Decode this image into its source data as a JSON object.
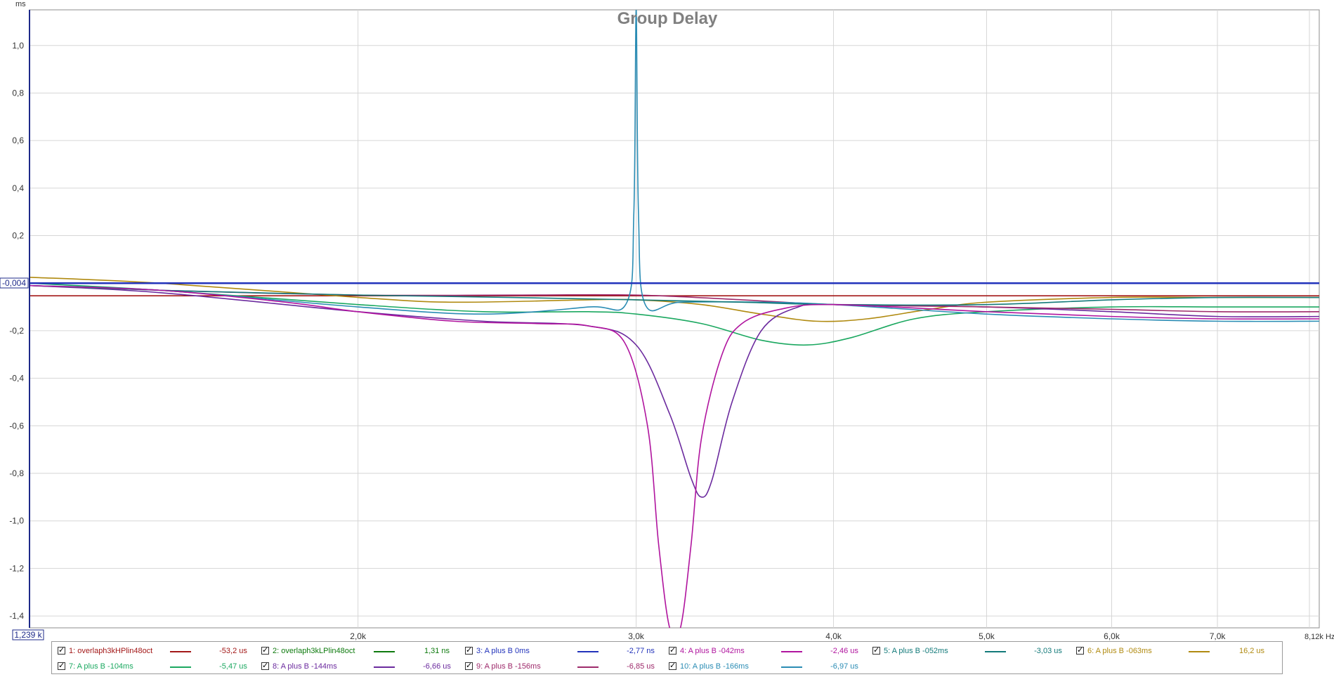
{
  "chart_data": {
    "type": "line",
    "title": "Group Delay",
    "ylabel": "ms",
    "x_unit": "Hz",
    "x_scale": "log",
    "xlim": [
      1239,
      8120
    ],
    "ylim": [
      -1.45,
      1.15
    ],
    "grid": true,
    "y_ticks": [
      1.0,
      0.8,
      0.6,
      0.4,
      0.2,
      -0.2,
      -0.4,
      -0.6,
      -0.8,
      -1.0,
      -1.2,
      -1.4
    ],
    "y_tick_labels": [
      "1,0",
      "0,8",
      "0,6",
      "0,4",
      "0,2",
      "-0,2",
      "-0,4",
      "-0,6",
      "-0,8",
      "-1,0",
      "-1,2",
      "-1,4"
    ],
    "x_ticks": [
      2000,
      3000,
      4000,
      5000,
      6000,
      7000
    ],
    "x_tick_labels": [
      "2,0k",
      "3,0k",
      "4,0k",
      "5,0k",
      "6,0k",
      "7,0k"
    ],
    "x_end_label": "8,12k Hz",
    "x_start_label": "1,239 k",
    "y_cursor_label": "-0,004",
    "y_cursor_value": -0.004,
    "legend_position": "bottom",
    "series": [
      {
        "name": "1: overlaph3kHPlin48oct",
        "value_label": "-53,2 us",
        "color": "#a31818",
        "x": [
          1239,
          1500,
          2000,
          3000,
          4000,
          5000,
          6000,
          7000,
          8120
        ],
        "y": [
          -0.053,
          -0.053,
          -0.053,
          -0.053,
          -0.053,
          -0.053,
          -0.053,
          -0.053,
          -0.053
        ]
      },
      {
        "name": "2: overlaph3kLPlin48oct",
        "value_label": "1,31 ns",
        "color": "#0e7a0e",
        "x": [
          1239,
          2000,
          4000,
          8120
        ],
        "y": [
          0.0,
          0.0,
          0.0,
          0.0
        ]
      },
      {
        "name": "3: A plus B 0ms",
        "value_label": "-2,77 ns",
        "color": "#2233bb",
        "x": [
          1239,
          2000,
          4000,
          8120
        ],
        "y": [
          0.0,
          0.0,
          0.0,
          0.0
        ]
      },
      {
        "name": "4: A plus B -042ms",
        "value_label": "-2,46 us",
        "color": "#b0149e",
        "x": [
          1239,
          1500,
          1800,
          2000,
          2300,
          2600,
          2800,
          2950,
          3050,
          3100,
          3150,
          3200,
          3250,
          3300,
          3400,
          3500,
          3700,
          4000,
          5000,
          6000,
          7000,
          8120
        ],
        "y": [
          -0.01,
          -0.03,
          -0.08,
          -0.12,
          -0.16,
          -0.17,
          -0.18,
          -0.25,
          -0.6,
          -1.1,
          -1.45,
          -1.45,
          -1.1,
          -0.65,
          -0.3,
          -0.17,
          -0.11,
          -0.09,
          -0.12,
          -0.14,
          -0.15,
          -0.15
        ]
      },
      {
        "name": "5: A plus B -052ms",
        "value_label": "-3,03 us",
        "color": "#137a7a",
        "x": [
          1239,
          1500,
          2000,
          2500,
          3000,
          3500,
          4000,
          5000,
          6000,
          7000,
          8120
        ],
        "y": [
          -0.01,
          -0.03,
          -0.05,
          -0.06,
          -0.07,
          -0.08,
          -0.09,
          -0.09,
          -0.07,
          -0.06,
          -0.06
        ]
      },
      {
        "name": "6: A plus B -063ms",
        "value_label": "16,2 us",
        "color": "#b08a10",
        "x": [
          1239,
          1500,
          2000,
          2300,
          2800,
          3000,
          3300,
          3600,
          3900,
          4200,
          4600,
          5000,
          6000,
          7000,
          8120
        ],
        "y": [
          0.025,
          0.0,
          -0.06,
          -0.08,
          -0.07,
          -0.07,
          -0.09,
          -0.13,
          -0.16,
          -0.15,
          -0.11,
          -0.08,
          -0.06,
          -0.06,
          -0.06
        ]
      },
      {
        "name": "7: A plus B -104ms",
        "value_label": "-5,47 us",
        "color": "#1ba860",
        "x": [
          1239,
          1500,
          2000,
          2400,
          2800,
          3000,
          3300,
          3600,
          3850,
          4100,
          4500,
          5000,
          6000,
          7000,
          8120
        ],
        "y": [
          0.0,
          -0.03,
          -0.09,
          -0.12,
          -0.12,
          -0.13,
          -0.17,
          -0.24,
          -0.26,
          -0.23,
          -0.15,
          -0.12,
          -0.1,
          -0.1,
          -0.1
        ]
      },
      {
        "name": "8: A plus B -144ms",
        "value_label": "-6,66 us",
        "color": "#6b2a9e",
        "x": [
          1239,
          1500,
          2000,
          2400,
          2800,
          3000,
          3150,
          3250,
          3300,
          3350,
          3450,
          3600,
          3800,
          4000,
          5000,
          6000,
          7000,
          8120
        ],
        "y": [
          -0.01,
          -0.04,
          -0.12,
          -0.16,
          -0.18,
          -0.26,
          -0.55,
          -0.82,
          -0.9,
          -0.83,
          -0.5,
          -0.2,
          -0.1,
          -0.09,
          -0.1,
          -0.12,
          -0.14,
          -0.14
        ]
      },
      {
        "name": "9: A plus B -156ms",
        "value_label": "-6,85 us",
        "color": "#9e2a6b",
        "x": [
          1239,
          1500,
          2000,
          2500,
          3000,
          3500,
          4000,
          5000,
          6000,
          7000,
          8120
        ],
        "y": [
          -0.01,
          -0.03,
          -0.05,
          -0.05,
          -0.05,
          -0.07,
          -0.09,
          -0.1,
          -0.11,
          -0.12,
          -0.12
        ]
      },
      {
        "name": "10: A plus B -166ms",
        "value_label": "-6,97 us",
        "color": "#2a8cb4",
        "x": [
          1239,
          1500,
          2000,
          2400,
          2800,
          2960,
          2990,
          3000,
          3010,
          3040,
          3200,
          3600,
          4000,
          5000,
          6000,
          7000,
          8120
        ],
        "y": [
          -0.01,
          -0.03,
          -0.1,
          -0.13,
          -0.1,
          -0.08,
          0.3,
          1.15,
          0.3,
          -0.09,
          -0.08,
          -0.08,
          -0.09,
          -0.13,
          -0.15,
          -0.16,
          -0.16
        ]
      }
    ]
  }
}
